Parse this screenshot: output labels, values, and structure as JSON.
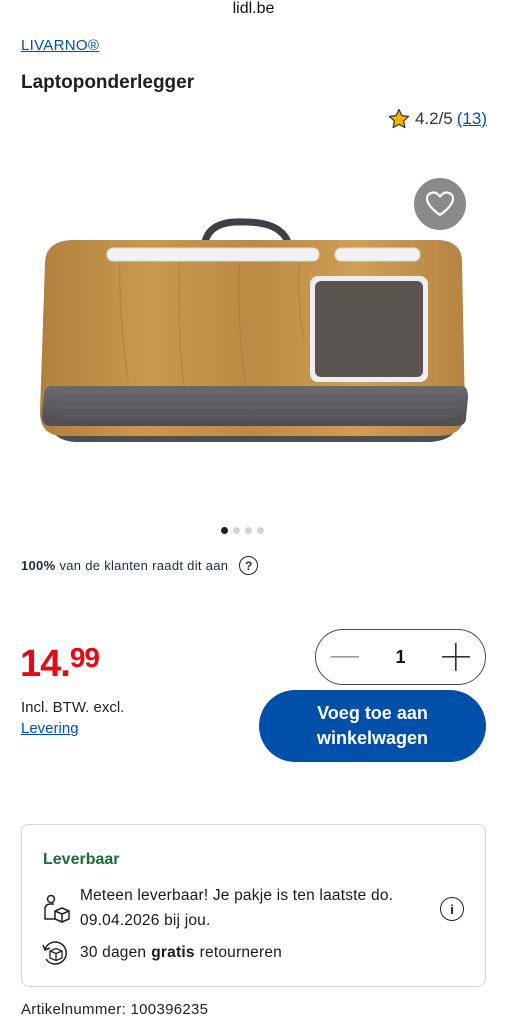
{
  "browser": {
    "url": "lidl.be"
  },
  "product": {
    "brand": "LIVARNO®",
    "title": "Laptoponderlegger",
    "rating": {
      "score": "4.2/5",
      "count": "(13)"
    },
    "gallery": {
      "total": 4,
      "active": 1
    },
    "recommend": {
      "percent": "100%",
      "text": "van de klanten raadt dit aan",
      "help": "?"
    },
    "price": {
      "integer": "14.",
      "decimals": "99"
    },
    "vat": {
      "text": "Incl. BTW. excl.",
      "link": "Levering"
    },
    "quantity": {
      "value": "1"
    },
    "add_to_cart": "Voeg toe aan winkelwagen",
    "availability": {
      "status": "Leverbaar",
      "delivery_text": "Meteen leverbaar! Je pakje is ten laatste do. 09.04.2026 bij jou.",
      "info": "i",
      "returns_prefix": "30 dagen",
      "returns_bold": "gratis",
      "returns_suffix": "retourneren"
    },
    "article_number": "Artikelnummer: 100396235"
  },
  "colors": {
    "brand_blue": "#0050aa",
    "price_red": "#e60a14",
    "available_green": "#1a6b3a"
  }
}
